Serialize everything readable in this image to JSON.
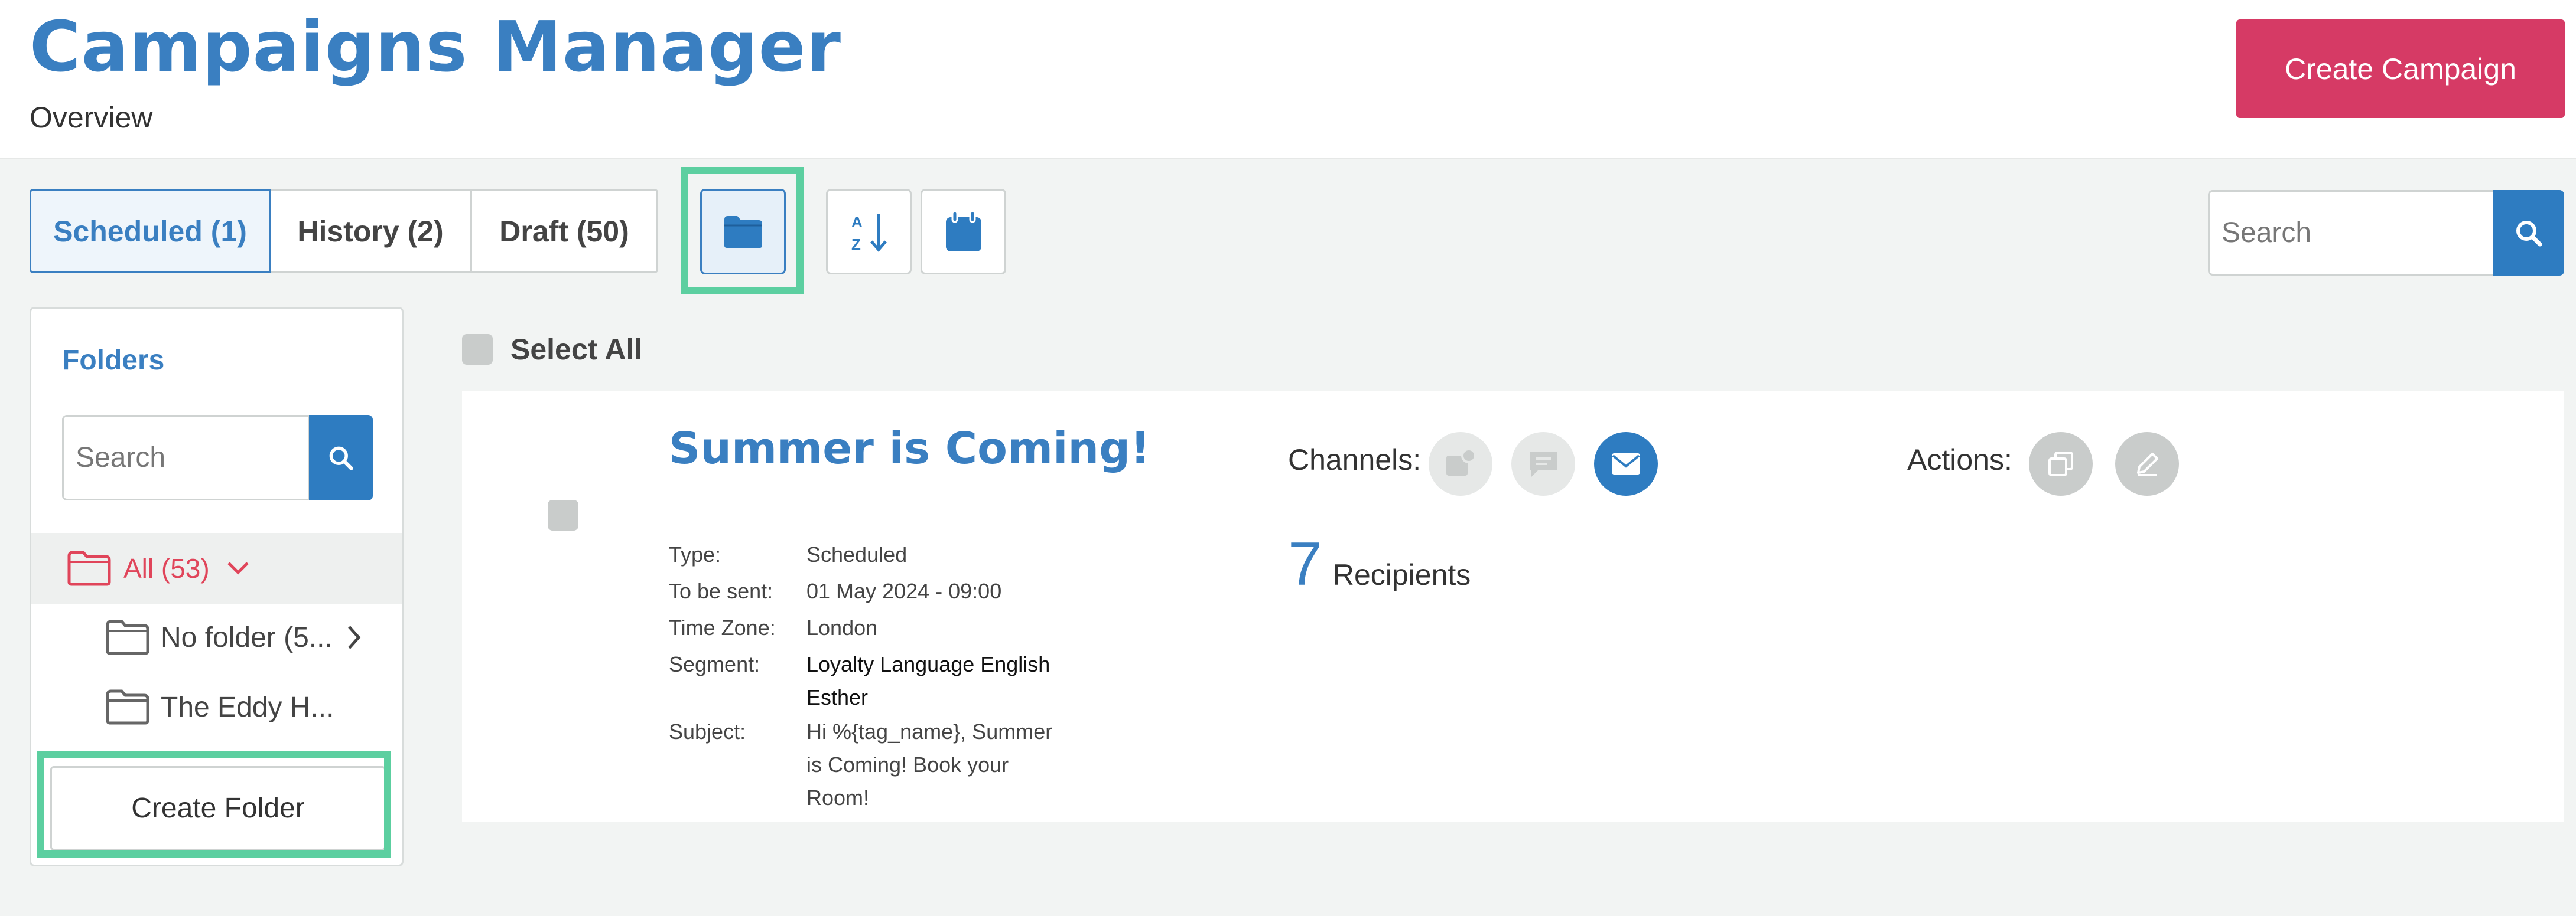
{
  "header": {
    "title": "Campaigns Manager",
    "subtitle": "Overview",
    "create_campaign_label": "Create Campaign"
  },
  "tabs": [
    {
      "label": "Scheduled (1)",
      "active": true
    },
    {
      "label": "History (2)",
      "active": false
    },
    {
      "label": "Draft (50)",
      "active": false
    }
  ],
  "toolbar": {
    "folder_icon": "folder-icon",
    "sort_icon": "sort-az-icon",
    "calendar_icon": "calendar-icon",
    "search_placeholder": "Search",
    "search_icon": "search-icon"
  },
  "sidebar": {
    "title": "Folders",
    "search_placeholder": "Search",
    "folders": [
      {
        "label": "All (53)",
        "selected": true
      },
      {
        "label": "No folder (5..."
      },
      {
        "label": "The Eddy H..."
      }
    ],
    "create_folder_label": "Create Folder"
  },
  "main": {
    "select_all_label": "Select All",
    "campaign": {
      "title": "Summer is Coming!",
      "details": [
        {
          "key": "Type:",
          "value": "Scheduled"
        },
        {
          "key": "To be sent:",
          "value": "01 May 2024 - 09:00"
        },
        {
          "key": "Time Zone:",
          "value": "London"
        },
        {
          "key": "Segment:",
          "value": "Loyalty Language English Esther"
        },
        {
          "key": "Subject:",
          "value": "Hi %{tag_name}, Summer is Coming! Book your Room!"
        }
      ],
      "channels_label": "Channels:",
      "recipients_count": "7",
      "recipients_label": "Recipients",
      "actions_label": "Actions:"
    }
  },
  "colors": {
    "brand_blue": "#3a7fc1",
    "button_blue": "#2e7cc1",
    "create_campaign_red": "#d63a65",
    "folder_all_red": "#e0455a",
    "highlight_green": "#5ccfa0"
  }
}
